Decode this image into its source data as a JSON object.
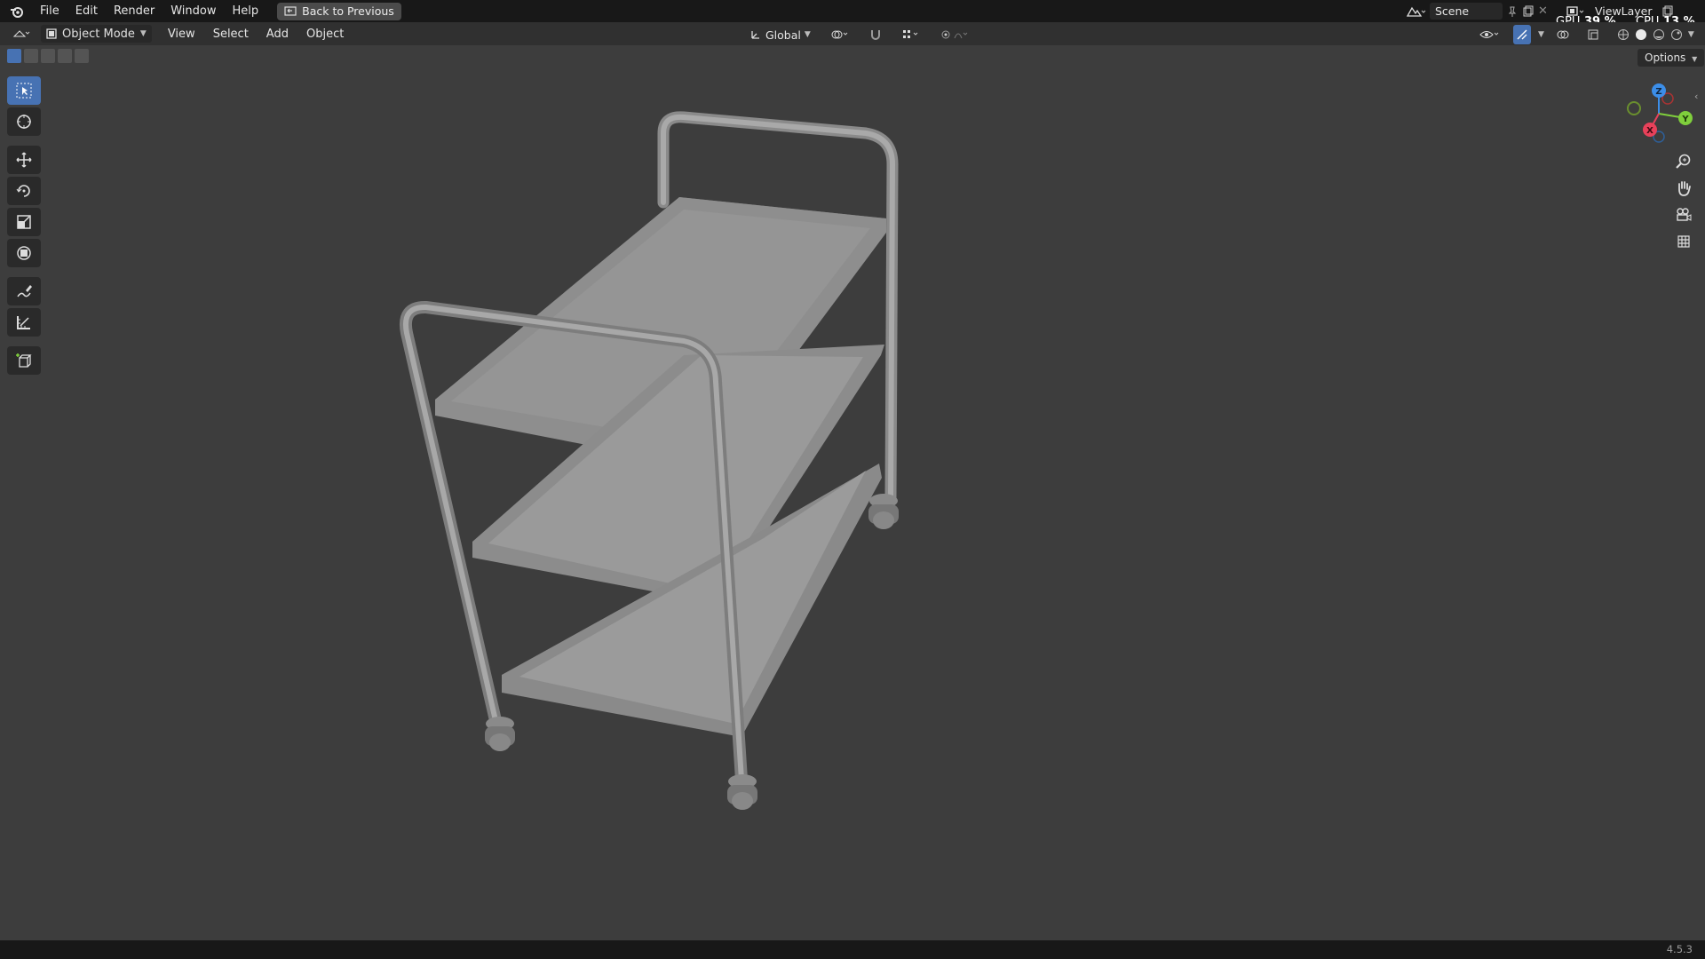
{
  "topbar": {
    "menus": [
      "File",
      "Edit",
      "Render",
      "Window",
      "Help"
    ],
    "back_button": "Back to Previous",
    "scene": "Scene",
    "view_layer": "ViewLayer",
    "gpu_label": "GPU",
    "gpu_value": "39 %",
    "cpu_label": "CPU",
    "cpu_value": "13 %"
  },
  "viewport_header": {
    "mode": "Object Mode",
    "menus": [
      "View",
      "Select",
      "Add",
      "Object"
    ],
    "transform_orientation": "Global"
  },
  "viewport": {
    "options_label": "Options",
    "gizmo_axes": [
      "Z",
      "Y",
      "X"
    ],
    "object": "trolley-cart"
  },
  "toolbar": {
    "tools": [
      "select-box",
      "cursor",
      "move",
      "rotate",
      "scale",
      "transform",
      "annotate",
      "measure",
      "add-cube"
    ],
    "active_tool": "select-box"
  },
  "statusbar": {
    "version": "4.5.3"
  },
  "colors": {
    "accent": "#4772b3",
    "axis_x": "#e8415a",
    "axis_y": "#7fcf3c",
    "axis_z": "#3c8ee8",
    "background": "#3d3d3d"
  }
}
